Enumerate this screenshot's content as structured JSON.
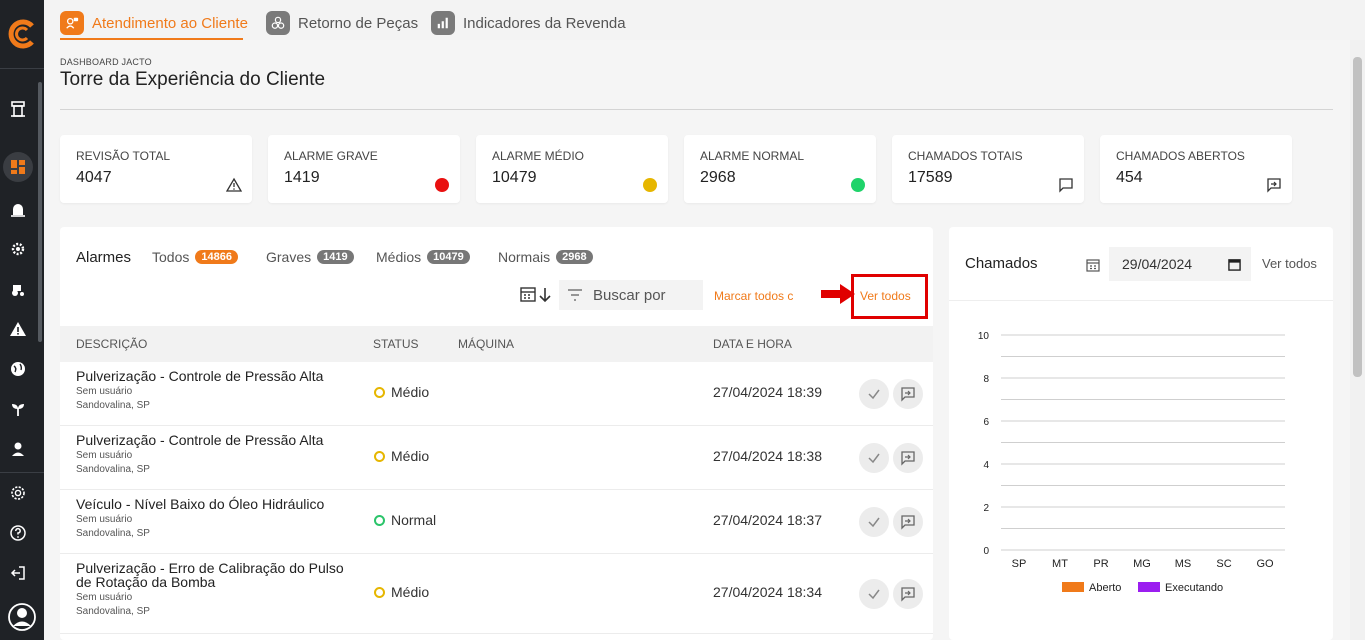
{
  "tabs": [
    {
      "label": "Atendimento ao Cliente",
      "active": true
    },
    {
      "label": "Retorno de Peças",
      "active": false
    },
    {
      "label": "Indicadores da Revenda",
      "active": false
    }
  ],
  "breadcrumb": "DASHBOARD JACTO",
  "page_title": "Torre da Experiência do Cliente",
  "cards": [
    {
      "label": "REVISÃO TOTAL",
      "value": "4047",
      "icon": "warning-icon"
    },
    {
      "label": "ALARME GRAVE",
      "value": "1419",
      "icon": "red-dot",
      "color": "#e91010"
    },
    {
      "label": "ALARME MÉDIO",
      "value": "10479",
      "icon": "yellow-dot",
      "color": "#e6b600"
    },
    {
      "label": "ALARME NORMAL",
      "value": "2968",
      "icon": "green-dot",
      "color": "#1fd36a"
    },
    {
      "label": "CHAMADOS TOTAIS",
      "value": "17589",
      "icon": "chat-icon"
    },
    {
      "label": "CHAMADOS ABERTOS",
      "value": "454",
      "icon": "open-chat-icon"
    }
  ],
  "alarms": {
    "title": "Alarmes",
    "filters": [
      {
        "label": "Todos",
        "count": "14866"
      },
      {
        "label": "Graves",
        "count": "1419"
      },
      {
        "label": "Médios",
        "count": "10479"
      },
      {
        "label": "Normais",
        "count": "2968"
      }
    ],
    "search_placeholder": "Buscar por",
    "mark_all": "Marcar todos c",
    "see_all": "Ver todos",
    "columns": [
      "DESCRIÇÃO",
      "STATUS",
      "MÁQUINA",
      "DATA E HORA"
    ],
    "rows": [
      {
        "desc": "Pulverização - Controle de Pressão Alta",
        "user": "Sem usuário",
        "location": "Sandovalina, SP",
        "status": "Médio",
        "datetime": "27/04/2024 18:39"
      },
      {
        "desc": "Pulverização - Controle de Pressão Alta",
        "user": "Sem usuário",
        "location": "Sandovalina, SP",
        "status": "Médio",
        "datetime": "27/04/2024 18:38"
      },
      {
        "desc": "Veículo - Nível Baixo do Óleo Hidráulico",
        "user": "Sem usuário",
        "location": "Sandovalina, SP",
        "status": "Normal",
        "datetime": "27/04/2024 18:37"
      },
      {
        "desc": "Pulverização - Erro de Calibração do Pulso de Rotação da Bomba",
        "user": "Sem usuário",
        "location": "Sandovalina, SP",
        "status": "Médio",
        "datetime": "27/04/2024 18:34"
      }
    ]
  },
  "chamados": {
    "title": "Chamados",
    "date": "29/04/2024",
    "see_all": "Ver todos"
  },
  "chart_data": {
    "type": "bar",
    "categories": [
      "SP",
      "MT",
      "PR",
      "MG",
      "MS",
      "SC",
      "GO"
    ],
    "series": [
      {
        "name": "Aberto",
        "color": "#f07a1a",
        "values": [
          0,
          0,
          0,
          0,
          0,
          0,
          0
        ]
      },
      {
        "name": "Executando",
        "color": "#9b1ef0",
        "values": [
          0,
          0,
          0,
          0,
          0,
          0,
          0
        ]
      }
    ],
    "ylim": [
      0,
      10
    ],
    "yticks": [
      "0",
      "2",
      "4",
      "6",
      "8",
      "10"
    ],
    "legend": "bottom"
  }
}
